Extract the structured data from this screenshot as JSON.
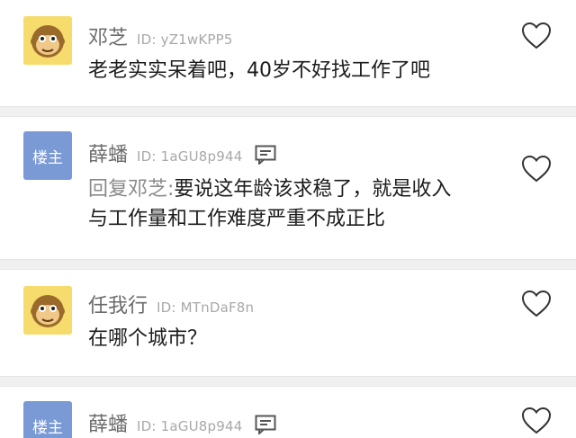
{
  "comments": [
    {
      "user": "邓芝",
      "id": "ID: yZ1wKPP5",
      "avatar": "monkey-avatar",
      "line1": "老老实实呆着吧，40岁不好找工作了吧"
    },
    {
      "user": "薛蟠",
      "id": "ID: 1aGU8p944",
      "avatar": "owner-badge",
      "badge": "楼主",
      "reply_prefix": "回复邓芝:",
      "line1": "要说这年龄该求稳了，就是收入",
      "line2": "与工作量和工作难度严重不成正比"
    },
    {
      "user": "任我行",
      "id": "ID: MTnDaF8n",
      "avatar": "monkey-avatar",
      "line1": "在哪个城市？"
    },
    {
      "user": "薛蟠",
      "id": "ID: 1aGU8p944",
      "avatar": "owner-badge",
      "badge": "楼主"
    }
  ],
  "colors": {
    "owner_badge": "#7a9ad6",
    "monkey_face": "#f3d35a",
    "separator": "#f0f0f0"
  }
}
